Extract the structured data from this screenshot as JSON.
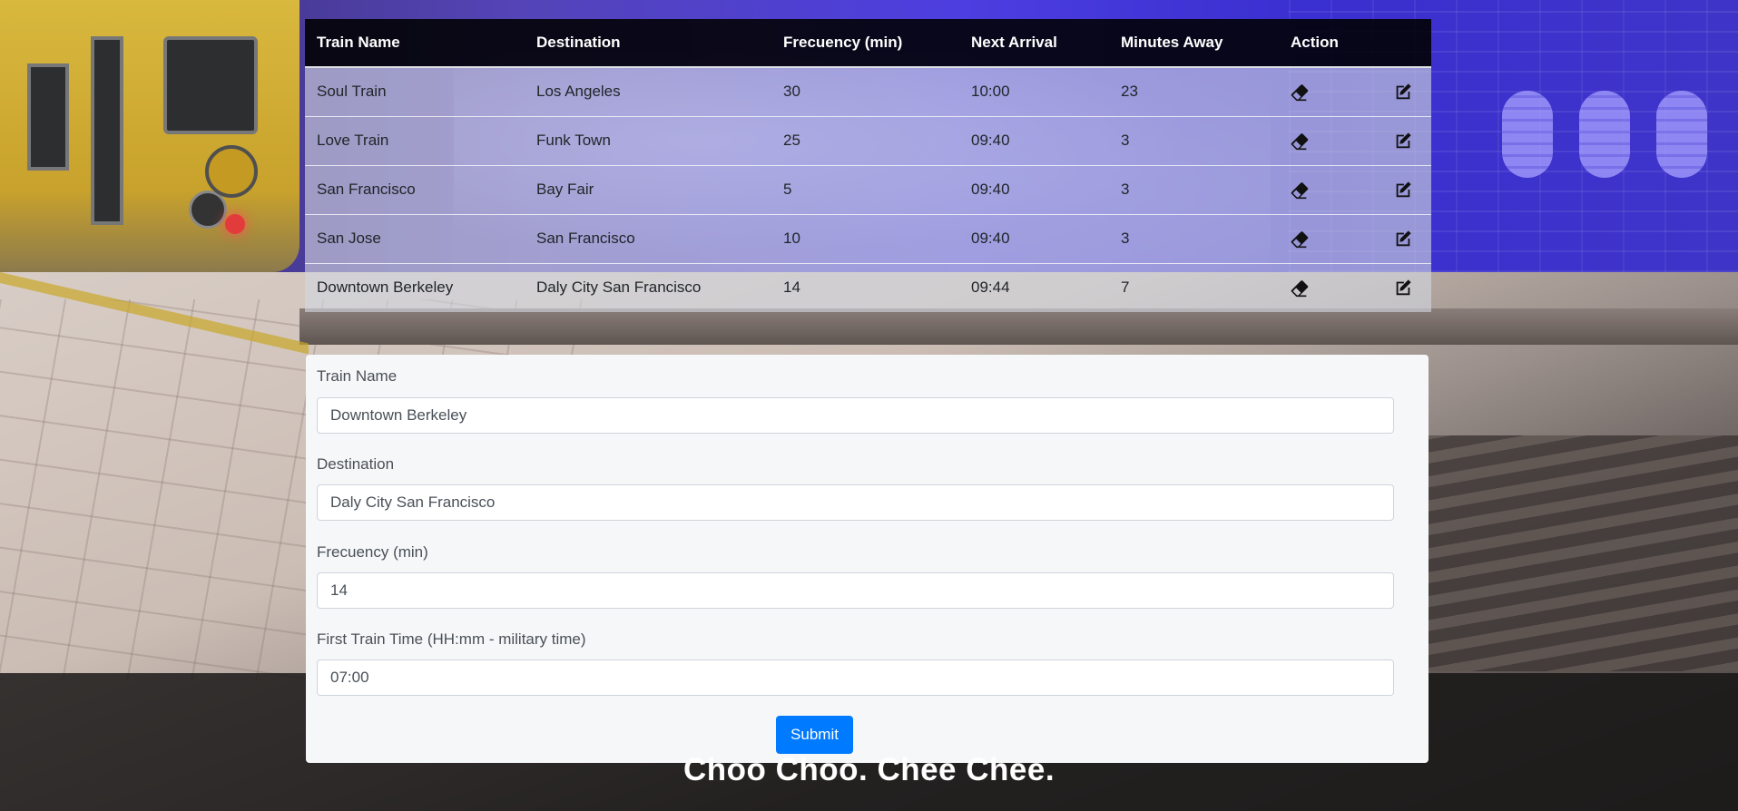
{
  "table": {
    "headers": [
      "Train Name",
      "Destination",
      "Frecuency (min)",
      "Next Arrival",
      "Minutes Away",
      "Action"
    ],
    "rows": [
      {
        "name": "Soul Train",
        "destination": "Los Angeles",
        "frequency": "30",
        "next_arrival": "10:00",
        "minutes_away": "23"
      },
      {
        "name": "Love Train",
        "destination": "Funk Town",
        "frequency": "25",
        "next_arrival": "09:40",
        "minutes_away": "3"
      },
      {
        "name": "San Francisco",
        "destination": "Bay Fair",
        "frequency": "5",
        "next_arrival": "09:40",
        "minutes_away": "3"
      },
      {
        "name": "San Jose",
        "destination": "San Francisco",
        "frequency": "10",
        "next_arrival": "09:40",
        "minutes_away": "3"
      },
      {
        "name": "Downtown Berkeley",
        "destination": "Daly City San Francisco",
        "frequency": "14",
        "next_arrival": "09:44",
        "minutes_away": "7"
      }
    ],
    "action_icons": [
      "eraser-icon",
      "edit-icon"
    ]
  },
  "form": {
    "train_name_label": "Train Name",
    "train_name_value": "Downtown Berkeley",
    "destination_label": "Destination",
    "destination_value": "Daly City San Francisco",
    "frequency_label": "Frecuency (min)",
    "frequency_value": "14",
    "first_time_label": "First Train Time (HH:mm - military time)",
    "first_time_value": "07:00",
    "submit_label": "Submit"
  },
  "tagline": "Choo Choo. Chee Chee.",
  "colors": {
    "primary": "#007bff",
    "table_header_bg": "#000000",
    "card_bg": "#f6f7f9"
  }
}
